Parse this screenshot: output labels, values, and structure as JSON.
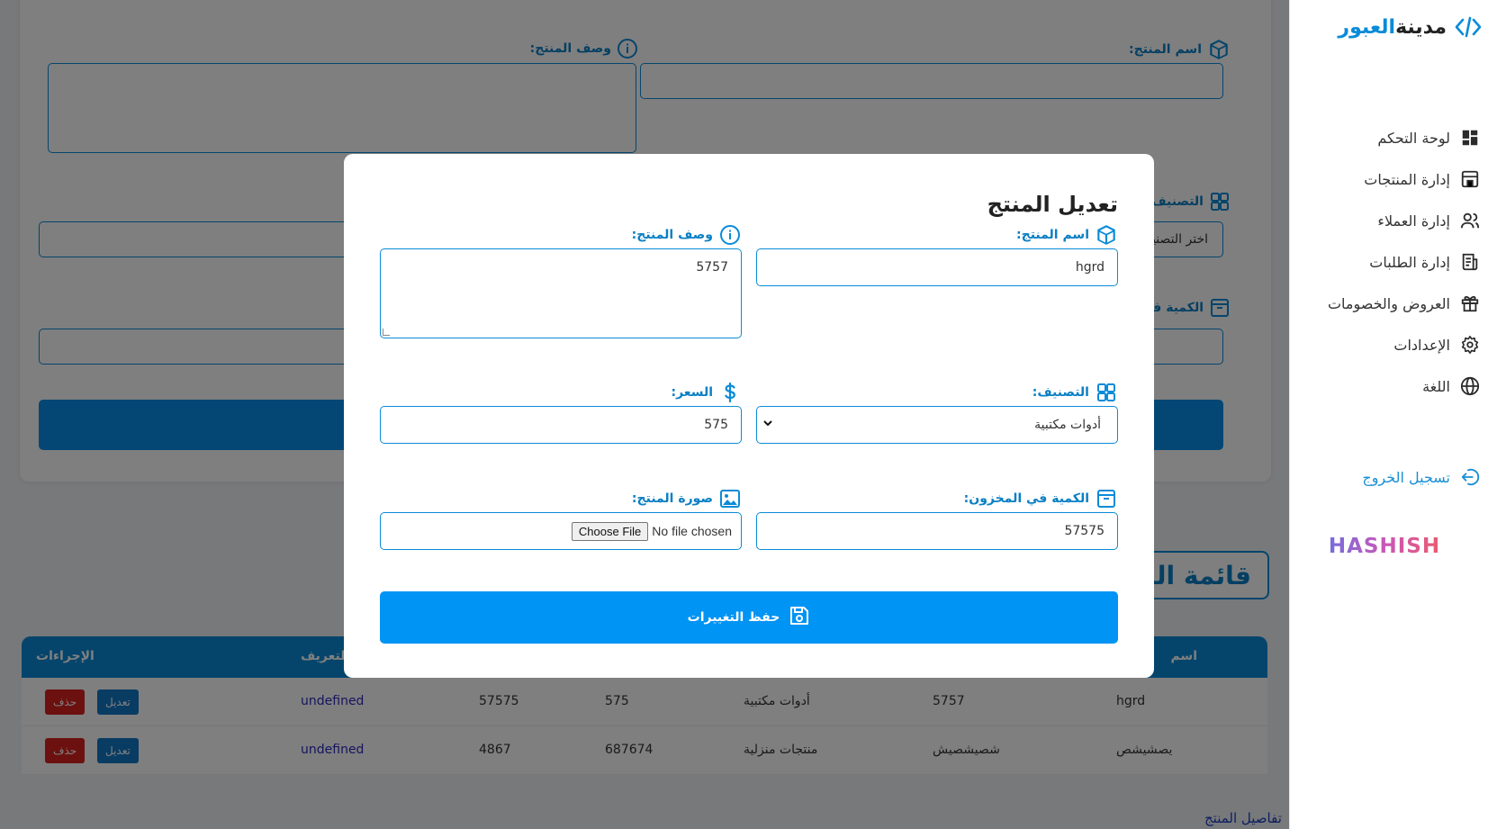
{
  "brand": {
    "name_part1": "مدينة",
    "name_part2": "العبور"
  },
  "sidebar": {
    "items": [
      {
        "label": "لوحة التحكم",
        "icon": "dashboard-icon"
      },
      {
        "label": "إدارة المنتجات",
        "icon": "store-icon"
      },
      {
        "label": "إدارة العملاء",
        "icon": "users-icon"
      },
      {
        "label": "إدارة الطلبات",
        "icon": "orders-icon"
      },
      {
        "label": "العروض والخصومات",
        "icon": "gift-icon"
      },
      {
        "label": "الإعدادات",
        "icon": "gear-icon"
      },
      {
        "label": "اللغة",
        "icon": "globe-icon"
      }
    ],
    "logout_label": "تسجيل الخروج",
    "footer_logo": "HASHISH"
  },
  "background_form": {
    "name_label": "اسم المنتج:",
    "description_label": "وصف المنتج:",
    "category_label": "التصنيف:",
    "category_placeholder": "اختر التصنيف",
    "stock_label": "الكمية في ا"
  },
  "products_list": {
    "title": "قائمة المنت",
    "columns": [
      "اسم",
      "التعريف",
      "الإجراءات"
    ],
    "rows": [
      {
        "name": "hgrd",
        "description": "5757",
        "category": "أدوات مكتبية",
        "price": "575",
        "stock": "57575",
        "definition": "undefined",
        "edit_label": "تعديل",
        "delete_label": "حذف"
      },
      {
        "name": "يصشيشص",
        "description": "شصيشصيش",
        "category": "منتجات منزلية",
        "price": "687674",
        "stock": "4867",
        "definition": "undefined",
        "edit_label": "تعديل",
        "delete_label": "حذف"
      }
    ]
  },
  "footer_link": "تفاصيل المنتج",
  "modal": {
    "title": "تعديل المنتج",
    "name_label": "اسم المنتج:",
    "name_value": "hgrd",
    "description_label": "وصف المنتج:",
    "description_value": "5757",
    "category_label": "التصنيف:",
    "category_value": "أدوات مكتبية",
    "price_label": "السعر:",
    "price_value": "575",
    "stock_label": "الكمية في المخزون:",
    "stock_value": "57575",
    "image_label": "صورة المنتج:",
    "file_status": "No file chosen",
    "file_button": "Choose File",
    "save_label": "حفظ التغييرات"
  },
  "colors": {
    "accent": "#0a8bd8",
    "save_button": "#0094f4",
    "delete": "#d8231e",
    "edit": "#1279c6"
  }
}
